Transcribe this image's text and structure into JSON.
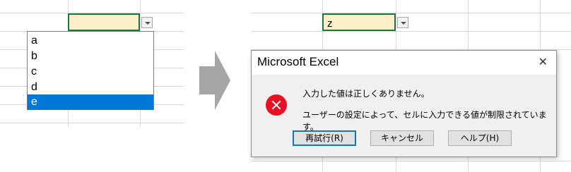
{
  "left_panel": {
    "dropdown_items": [
      "a",
      "b",
      "c",
      "d",
      "e"
    ],
    "selected_item": "e"
  },
  "right_panel": {
    "cell_value": "z"
  },
  "dialog": {
    "title": "Microsoft Excel",
    "close_glyph": "✕",
    "message_line1": "入力した値は正しくありません。",
    "message_line2": "ユーザーの設定によって、セルに入力できる値が制限されています。",
    "buttons": {
      "retry": "再試行(R)",
      "cancel": "キャンセル",
      "help": "ヘルプ(H)"
    }
  },
  "colors": {
    "active_cell_fill": "#fdefc6",
    "active_cell_border": "#217346",
    "selection_blue": "#0078d7",
    "error_red": "#e81123",
    "arrow_gray": "#a6a6a6"
  },
  "icons": {
    "dropdown": "chevron-down-icon",
    "error": "error-x-icon",
    "transition": "right-arrow-icon",
    "close": "close-icon"
  }
}
